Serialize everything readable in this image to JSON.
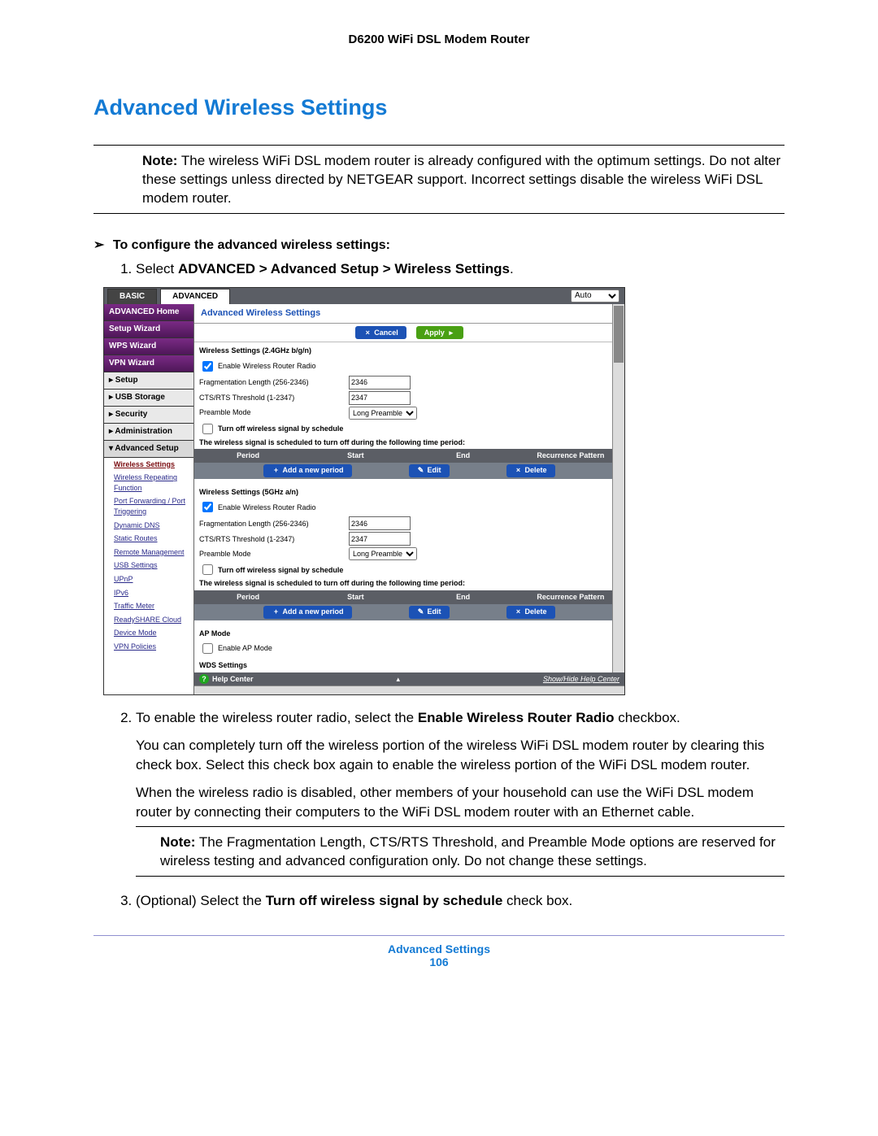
{
  "doc": {
    "header": "D6200 WiFi DSL Modem Router",
    "section_title": "Advanced Wireless Settings",
    "note1_label": "Note:",
    "note1_body": " The wireless WiFi DSL modem router is already configured with the optimum settings. Do not alter these settings unless directed by NETGEAR support. Incorrect settings disable the wireless WiFi DSL modem router.",
    "arrow_symbol": "➢",
    "arrow_text": "To configure the advanced wireless settings:",
    "step1_pre": "Select ",
    "step1_bold": "ADVANCED > Advanced Setup > Wireless Settings",
    "step1_post": ".",
    "step2_pre": "To enable the wireless router radio, select the ",
    "step2_bold": "Enable Wireless Router Radio",
    "step2_post": " checkbox.",
    "step2_p1": "You can completely turn off the wireless portion of the wireless WiFi DSL modem router by clearing this check box. Select this check box again to enable the wireless portion of the WiFi DSL modem router.",
    "step2_p2": "When the wireless radio is disabled, other members of your household can use the WiFi DSL modem router by connecting their computers to the WiFi DSL modem router with an Ethernet cable.",
    "note2_label": "Note:",
    "note2_body": " The Fragmentation Length, CTS/RTS Threshold, and Preamble Mode options are reserved for wireless testing and advanced configuration only. Do not change these settings.",
    "step3_pre": "(Optional) Select the ",
    "step3_bold": "Turn off wireless signal by schedule",
    "step3_post": " check box.",
    "footer_title": "Advanced Settings",
    "footer_page": "106"
  },
  "ui": {
    "tab_basic": "BASIC",
    "tab_advanced": "ADVANCED",
    "auto_option": "Auto",
    "sidebar": {
      "adv_home": "ADVANCED Home",
      "setup_wizard": "Setup Wizard",
      "wps_wizard": "WPS Wizard",
      "vpn_wizard": "VPN Wizard",
      "setup": "▸ Setup",
      "usb": "▸ USB Storage",
      "security": "▸ Security",
      "admin": "▸ Administration",
      "adv_setup": "▾ Advanced Setup",
      "subs": {
        "wireless_settings": "Wireless Settings",
        "wireless_repeating": "Wireless Repeating Function",
        "port_fwd": "Port Forwarding / Port Triggering",
        "dyn_dns": "Dynamic DNS",
        "static_routes": "Static Routes",
        "remote_mgmt": "Remote Management",
        "usb_settings": "USB Settings",
        "upnp": "UPnP",
        "ipv6": "IPv6",
        "traffic_meter": "Traffic Meter",
        "readyshare": "ReadySHARE Cloud",
        "device_mode": "Device Mode",
        "vpn_policies": "VPN Policies"
      }
    },
    "panel": {
      "title": "Advanced Wireless Settings",
      "btn_cancel": "Cancel",
      "btn_apply": "Apply",
      "btn_add": "Add a new period",
      "btn_edit": "Edit",
      "btn_delete": "Delete",
      "g24_title": "Wireless Settings (2.4GHz b/g/n)",
      "g5_title": "Wireless Settings (5GHz a/n)",
      "enable_radio": "Enable Wireless Router Radio",
      "frag_label": "Fragmentation Length (256-2346)",
      "frag_value": "2346",
      "cts_label": "CTS/RTS Threshold (1-2347)",
      "cts_value": "2347",
      "preamble_label": "Preamble Mode",
      "preamble_value": "Long Preamble",
      "turnoff_label": "Turn off wireless signal by schedule",
      "sched_note": "The wireless signal is scheduled to turn off during the following time period:",
      "col_period": "Period",
      "col_start": "Start",
      "col_end": "End",
      "col_recur": "Recurrence Pattern",
      "ap_mode_title": "AP Mode",
      "enable_ap": "Enable AP Mode",
      "wds_title": "WDS Settings",
      "help_center": "Help Center",
      "show_hide": "Show/Hide Help Center"
    }
  }
}
